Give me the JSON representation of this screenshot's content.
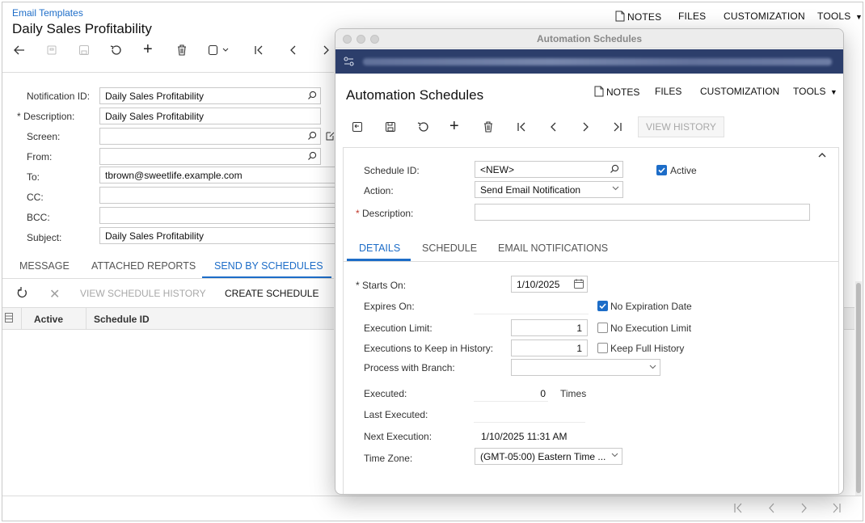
{
  "breadcrumb": "Email Templates",
  "page_title": "Daily Sales Profitability",
  "top_nav": {
    "notes": "NOTES",
    "files": "FILES",
    "customization": "CUSTOMIZATION",
    "tools": "TOOLS"
  },
  "form": {
    "notification_id_label": "Notification ID:",
    "notification_id_value": "Daily Sales Profitability",
    "description_label": "Description:",
    "description_value": "Daily Sales Profitability",
    "screen_label": "Screen:",
    "screen_value": "",
    "from_label": "From:",
    "from_value": "",
    "to_label": "To:",
    "to_value": "tbrown@sweetlife.example.com",
    "cc_label": "CC:",
    "cc_value": "",
    "bcc_label": "BCC:",
    "bcc_value": "",
    "subject_label": "Subject:",
    "subject_value": "Daily Sales Profitability"
  },
  "tabs": {
    "message": "MESSAGE",
    "attached_reports": "ATTACHED REPORTS",
    "send_by_schedules": "SEND BY SCHEDULES"
  },
  "grid_toolbar": {
    "view_schedule_history": "VIEW SCHEDULE HISTORY",
    "create_schedule": "CREATE SCHEDULE"
  },
  "grid_columns": {
    "active": "Active",
    "schedule_id": "Schedule ID"
  },
  "modal": {
    "window_title": "Automation Schedules",
    "title": "Automation Schedules",
    "nav": {
      "notes": "NOTES",
      "files": "FILES",
      "customization": "CUSTOMIZATION",
      "tools": "TOOLS"
    },
    "view_history": "VIEW HISTORY",
    "schedule_id_label": "Schedule ID:",
    "schedule_id_value": "<NEW>",
    "active_label": "Active",
    "action_label": "Action:",
    "action_value": "Send Email Notification",
    "description_label": "Description:",
    "description_value": "",
    "tabs": {
      "details": "DETAILS",
      "schedule": "SCHEDULE",
      "email_notifications": "EMAIL NOTIFICATIONS"
    },
    "details": {
      "starts_on_label": "Starts On:",
      "starts_on_value": "1/10/2025",
      "expires_on_label": "Expires On:",
      "no_expiration_label": "No Expiration Date",
      "execution_limit_label": "Execution Limit:",
      "execution_limit_value": "1",
      "no_execution_limit_label": "No Execution Limit",
      "executions_keep_label": "Executions to Keep in History:",
      "executions_keep_value": "1",
      "keep_full_history_label": "Keep Full History",
      "process_branch_label": "Process with Branch:",
      "process_branch_value": "",
      "executed_label": "Executed:",
      "executed_value": "0",
      "times_label": "Times",
      "last_executed_label": "Last Executed:",
      "last_executed_value": "",
      "next_execution_label": "Next Execution:",
      "next_execution_value": "1/10/2025 11:31 AM",
      "time_zone_label": "Time Zone:",
      "time_zone_value": "(GMT-05:00) Eastern Time ..."
    }
  },
  "colors": {
    "accent": "#1d6dc8",
    "url_bar": "#2c3e6b",
    "required": "#c0392b"
  }
}
